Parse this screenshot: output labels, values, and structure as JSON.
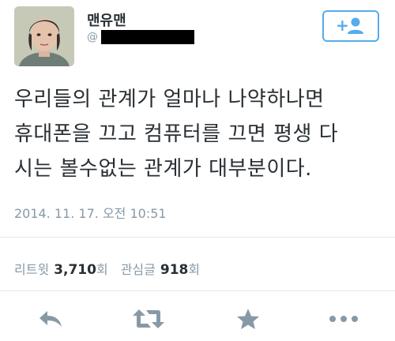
{
  "user": {
    "display_name": "맨유맨",
    "handle_prefix": "@",
    "avatar_icon": "user-avatar-photo"
  },
  "follow_button": {
    "icon": "follow-user-icon",
    "plus": "+",
    "color": "#55acee"
  },
  "tweet": {
    "lines": [
      "우리들의 관계가 얼마나 나약하나면",
      "휴대폰을 끄고 컴퓨터를 끄면 평생 다",
      "시는 볼수없는 관계가 대부분이다."
    ],
    "timestamp": "2014. 11. 17. 오전 10:51"
  },
  "stats": {
    "retweet_label": "리트윗",
    "retweet_count": "3,710",
    "retweet_unit": "회",
    "favorite_label": "관심글",
    "favorite_count": "918",
    "favorite_unit": "회"
  },
  "actions": {
    "reply_icon": "reply-icon",
    "retweet_icon": "retweet-icon",
    "favorite_icon": "star-icon",
    "more_icon": "more-icon",
    "icon_color": "#8899a6"
  }
}
